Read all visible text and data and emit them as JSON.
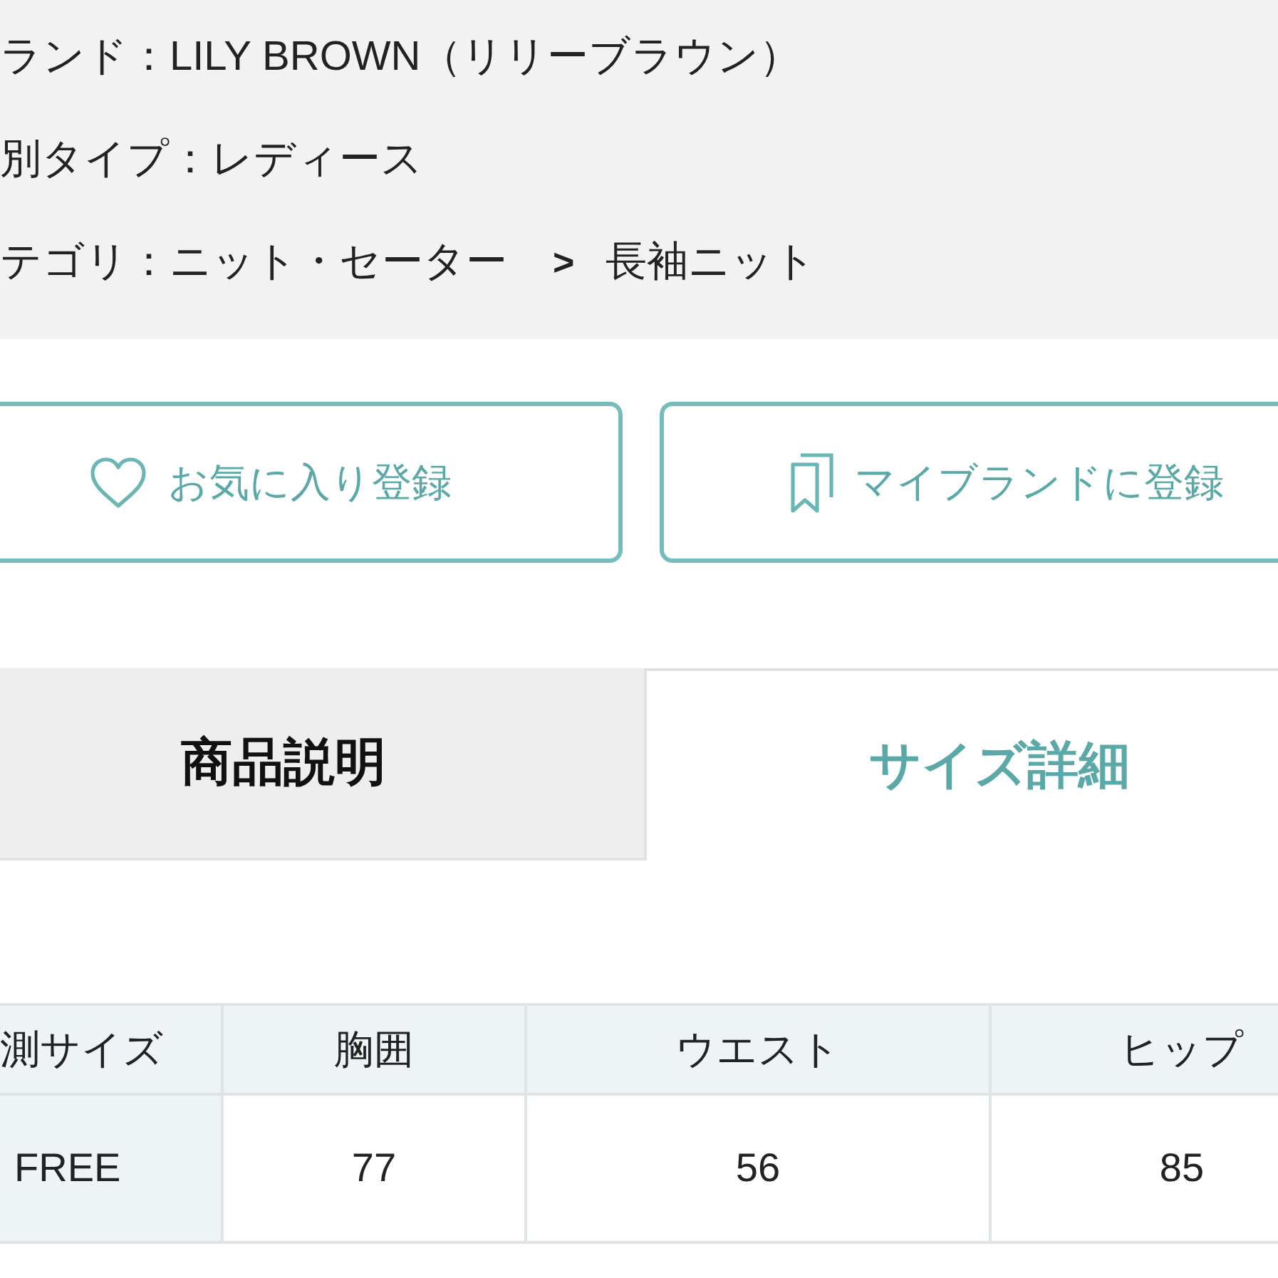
{
  "info": [
    {
      "kind": "text",
      "text": "ランド：LILY BROWN（リリーブラウン）"
    },
    {
      "kind": "text",
      "text": "別タイプ：レディース"
    },
    {
      "kind": "breadcrumb",
      "crumbs": [
        "テゴリ：ニット・セーター",
        "長袖ニット"
      ],
      "separator": ">"
    }
  ],
  "actions": [
    {
      "label": "お気に入り登録"
    },
    {
      "label": "マイブランドに登録"
    }
  ],
  "tabs": [
    {
      "label": "商品説明",
      "selected": false
    },
    {
      "label": "サイズ詳細",
      "selected": true
    }
  ],
  "size_table": {
    "columns": [
      "測サイズ",
      "胸囲",
      "ウエスト",
      "ヒップ"
    ],
    "rows": [
      [
        "FREE",
        "77",
        "56",
        "85"
      ]
    ]
  }
}
